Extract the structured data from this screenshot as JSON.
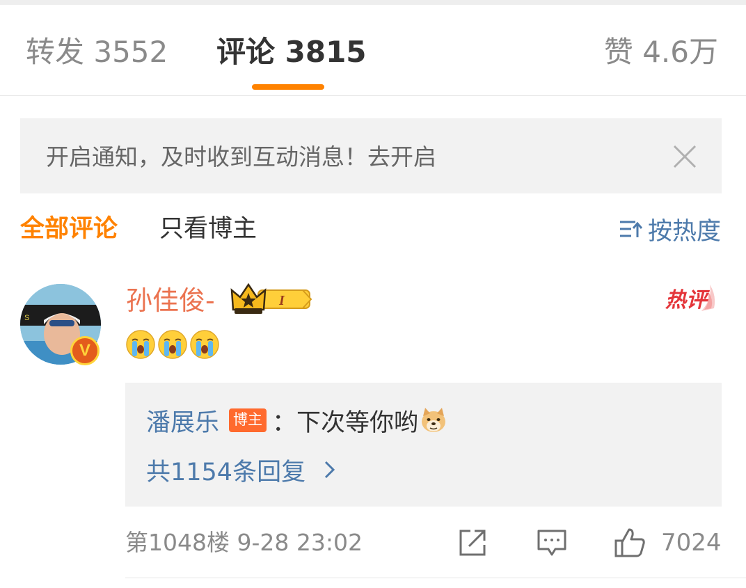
{
  "tabs": {
    "repost": "转发 3552",
    "comment": "评论 3815",
    "like": "赞 4.6万",
    "active_color": "#ff8200"
  },
  "notice": {
    "text": "开启通知，及时收到互动消息！去开启",
    "close_icon": "close-icon"
  },
  "filter": {
    "all": "全部评论",
    "owner_only": "只看博主",
    "sort": "按热度",
    "sort_icon": "sort-icon"
  },
  "comment": {
    "username": "孙佳俊-",
    "level_badge": "I",
    "hot_label": "热评",
    "verified_badge": "V",
    "emoji_names": [
      "crying-emoji",
      "crying-emoji",
      "crying-emoji"
    ],
    "reply": {
      "name": "潘展乐",
      "tag": "博主",
      "text": "：下次等你哟",
      "emoji": "doge-emoji",
      "more": "共1154条回复"
    },
    "meta": "第1048楼 9-28 23:02",
    "likes": "7024"
  },
  "colors": {
    "username": "#eb7350",
    "link": "#4d7aab",
    "hot": "#e4353a",
    "tag": "#ff6a2e"
  }
}
